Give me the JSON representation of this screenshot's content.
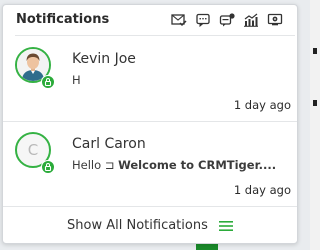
{
  "header": {
    "title": "Notifications",
    "icons": [
      "mail-check-icon",
      "chat-icon",
      "comment-alert-icon",
      "chart-icon",
      "monitor-settings-icon"
    ]
  },
  "notifications": [
    {
      "name": "Kevin Joe",
      "message": "H",
      "time": "1 day ago",
      "avatar": "photo"
    },
    {
      "name": "Carl Caron",
      "avatar_letter": "C",
      "message_prefix": "Hello ",
      "message_symbol": "⊐",
      "message_bold": "Welcome to CRMTiger....",
      "time": "1 day ago"
    }
  ],
  "footer": {
    "label": "Show All Notifications"
  },
  "colors": {
    "accent": "#35b244",
    "badge": "#2bab3a",
    "menu_icon": "#2bab3a"
  }
}
